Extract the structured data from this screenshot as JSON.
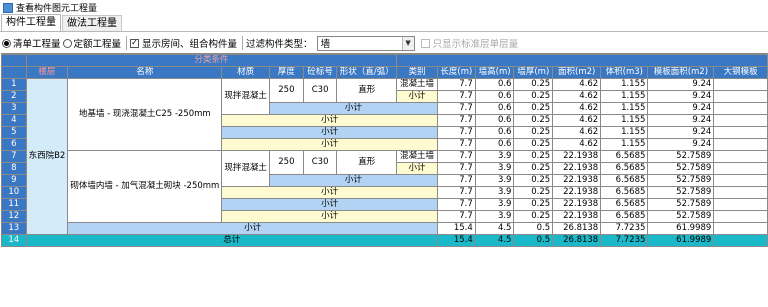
{
  "window": {
    "title": "查看构件图元工程量"
  },
  "tabs": [
    {
      "label": "构件工程量"
    },
    {
      "label": "做法工程量"
    }
  ],
  "toolbar": {
    "radio_list": "清单工程量",
    "radio_quota": "定额工程量",
    "check_show_room": "显示房间、组合构件量",
    "filter_label": "过滤构件类型：",
    "filter_value": "墙",
    "check_std_floor": "只显示标准层单层量"
  },
  "table": {
    "header_group": "分类条件",
    "headers": [
      "楼层",
      "名称",
      "材质",
      "厚度",
      "砼标号",
      "形状（直/弧）",
      "类别",
      "长度(m)",
      "墙高(m)",
      "墙厚(m)",
      "面积(m2)",
      "体积(m3)",
      "模板面积(m2)",
      "大钢模板"
    ],
    "floor": "东西院B2",
    "group1_name": "地基墙 - 现浇混凝土C25 -250mm",
    "group2_name": "砌体墙内墙 - 加气混凝土砌块 -250mm",
    "material": "现拌混凝土",
    "thickness": "250",
    "grade": "C30",
    "shape": "直形",
    "category": "混凝土墙",
    "subtotal": "小计",
    "total": "总计",
    "row_numbers": [
      "1",
      "2",
      "3",
      "4",
      "5",
      "6",
      "7",
      "8",
      "9",
      "10",
      "11",
      "12",
      "13",
      "14"
    ],
    "rows": [
      [
        "7.7",
        "0.6",
        "0.25",
        "4.62",
        "1.155",
        "9.24"
      ],
      [
        "7.7",
        "0.6",
        "0.25",
        "4.62",
        "1.155",
        "9.24"
      ],
      [
        "7.7",
        "0.6",
        "0.25",
        "4.62",
        "1.155",
        "9.24"
      ],
      [
        "7.7",
        "0.6",
        "0.25",
        "4.62",
        "1.155",
        "9.24"
      ],
      [
        "7.7",
        "0.6",
        "0.25",
        "4.62",
        "1.155",
        "9.24"
      ],
      [
        "7.7",
        "0.6",
        "0.25",
        "4.62",
        "1.155",
        "9.24"
      ],
      [
        "7.7",
        "3.9",
        "0.25",
        "22.1938",
        "6.5685",
        "52.7589"
      ],
      [
        "7.7",
        "3.9",
        "0.25",
        "22.1938",
        "6.5685",
        "52.7589"
      ],
      [
        "7.7",
        "3.9",
        "0.25",
        "22.1938",
        "6.5685",
        "52.7589"
      ],
      [
        "7.7",
        "3.9",
        "0.25",
        "22.1938",
        "6.5685",
        "52.7589"
      ],
      [
        "7.7",
        "3.9",
        "0.25",
        "22.1938",
        "6.5685",
        "52.7589"
      ],
      [
        "7.7",
        "3.9",
        "0.25",
        "22.1938",
        "6.5685",
        "52.7589"
      ],
      [
        "15.4",
        "4.5",
        "0.5",
        "26.8138",
        "7.7235",
        "61.9989"
      ],
      [
        "15.4",
        "4.5",
        "0.5",
        "26.8138",
        "7.7235",
        "61.9989"
      ]
    ]
  }
}
